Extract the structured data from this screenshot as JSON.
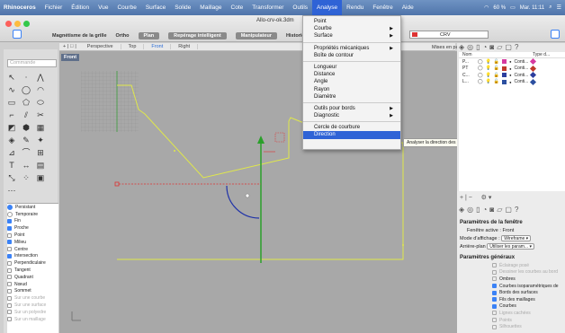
{
  "menubar": {
    "app": "Rhinoceros",
    "items": [
      "Fichier",
      "Édition",
      "Vue",
      "Courbe",
      "Surface",
      "Solide",
      "Maillage",
      "Cote",
      "Transformer",
      "Outils",
      "Analyse",
      "Rendu",
      "Fenêtre",
      "Aide"
    ],
    "active": "Analyse",
    "battery": "60 %",
    "clock": "Mar. 11:11"
  },
  "window": {
    "file_title": "Allo-crv-ok.3dm"
  },
  "toolbar": {
    "grid_snap": "Magnétisme de la grille",
    "ortho": "Ortho",
    "plan": "Plan",
    "smart_track": "Repérage intelligent",
    "gumball": "Manipulateur",
    "history": "Historiq",
    "layer_name": "CRV",
    "layer_color": "#dd3333"
  },
  "viewport_tabs": {
    "tabs": [
      "Perspective",
      "Top",
      "Front",
      "Right"
    ],
    "active": "Front",
    "layout_button": "Mises en page..."
  },
  "viewport": {
    "label": "Front"
  },
  "command": {
    "placeholder": "Commande"
  },
  "analyse_menu": {
    "items": [
      {
        "label": "Point",
        "submenu": false
      },
      {
        "label": "Courbe",
        "submenu": true
      },
      {
        "label": "Surface",
        "submenu": true
      },
      {
        "sep": true
      },
      {
        "label": "Propriétés mécaniques",
        "submenu": true
      },
      {
        "label": "Boîte de contour",
        "submenu": false
      },
      {
        "sep": true
      },
      {
        "label": "Longueur",
        "submenu": false
      },
      {
        "label": "Distance",
        "submenu": false
      },
      {
        "label": "Angle",
        "submenu": false
      },
      {
        "label": "Rayon",
        "submenu": false
      },
      {
        "label": "Diamètre",
        "submenu": false
      },
      {
        "sep": true
      },
      {
        "label": "Outils pour bords",
        "submenu": true
      },
      {
        "label": "Diagnostic",
        "submenu": true
      },
      {
        "sep": true
      },
      {
        "label": "Cercle de courbure",
        "submenu": false
      },
      {
        "label": "Direction",
        "submenu": false,
        "selected": true
      }
    ],
    "tooltip": "Analyser la direction des objets"
  },
  "osnaps": {
    "mode": [
      {
        "label": "Persistant",
        "selected": true
      },
      {
        "label": "Temporaire",
        "selected": false
      }
    ],
    "items": [
      {
        "label": "Fin",
        "on": true
      },
      {
        "label": "Proche",
        "on": true
      },
      {
        "label": "Point",
        "on": false
      },
      {
        "label": "Milieu",
        "on": true
      },
      {
        "label": "Centre",
        "on": false
      },
      {
        "label": "Intersection",
        "on": true
      },
      {
        "label": "Perpendiculaire",
        "on": false
      },
      {
        "label": "Tangent",
        "on": false
      },
      {
        "label": "Quadrant",
        "on": false
      },
      {
        "label": "Nœud",
        "on": false
      },
      {
        "label": "Sommet",
        "on": false
      },
      {
        "label": "Sur une courbe",
        "on": false,
        "dim": true
      },
      {
        "label": "Sur une surface",
        "on": false,
        "dim": true
      },
      {
        "label": "Sur un polyedre",
        "on": false,
        "dim": true
      },
      {
        "label": "Sur un maillage",
        "on": false,
        "dim": true
      }
    ]
  },
  "layers": {
    "headers": [
      "Nom",
      "Type d..."
    ],
    "rows": [
      {
        "name": "P...",
        "type": "Conti...",
        "color": "#d63aa0"
      },
      {
        "name": "PT",
        "type": "Conti...",
        "color": "#c0392b"
      },
      {
        "name": "C...",
        "type": "Conti...",
        "color": "#2c3e9e"
      },
      {
        "name": "L...",
        "type": "Conti...",
        "color": "#2c4fa0"
      }
    ]
  },
  "properties": {
    "title": "Paramètres de la fenêtre",
    "active_label": "Fenêtre active :",
    "active_value": "Front",
    "display_mode_label": "Mode d'affichage :",
    "display_mode_value": "Wireframe",
    "background_label": "Arrière-plan",
    "background_value": "Utiliser les param...",
    "general_title": "Paramètres généraux",
    "options": [
      {
        "label": "Éclairage posé",
        "on": false,
        "dim": true
      },
      {
        "label": "Dessiner les courbes au bord",
        "on": false,
        "dim": true
      },
      {
        "label": "Ombres",
        "on": false,
        "dim": false
      },
      {
        "label": "Courbes isoparamétriques de",
        "on": true
      },
      {
        "label": "Bords des surfaces",
        "on": true
      },
      {
        "label": "Fils des maillages",
        "on": true
      },
      {
        "label": "Courbes",
        "on": true
      },
      {
        "label": "Lignes cachées",
        "on": false,
        "dim": true
      },
      {
        "label": "Points",
        "on": false,
        "dim": true
      },
      {
        "label": "Silhouettes",
        "on": false,
        "dim": true
      }
    ]
  }
}
